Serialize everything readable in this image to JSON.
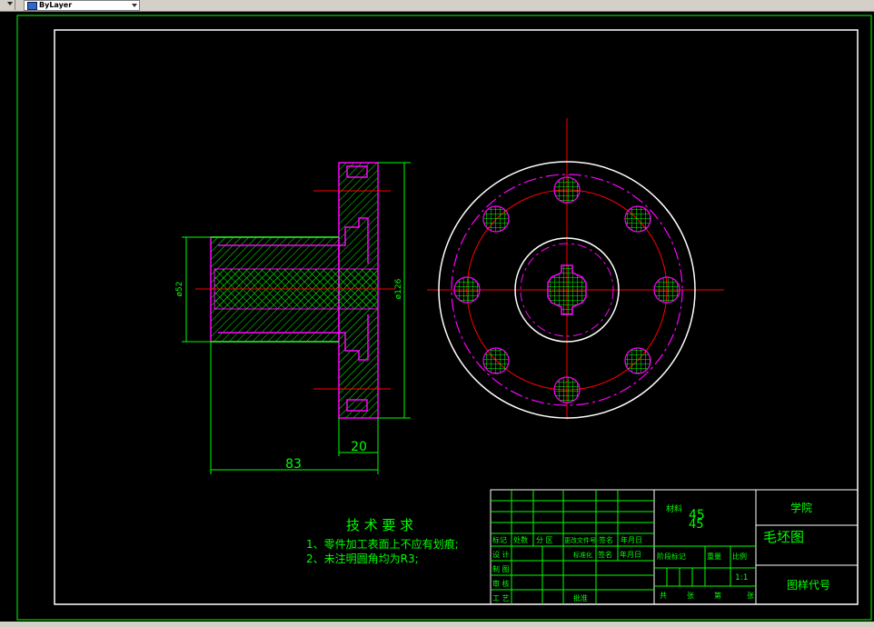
{
  "toolbar": {
    "combo_value": "ByLayer",
    "arrow_icon": "chevron-down-icon",
    "combo_icon": "layer-icon"
  },
  "colors": {
    "background": "#000000",
    "dimension": "#00ff00",
    "outline": "#ffffff",
    "center_line": "#ff0000",
    "hidden_line": "#ff00ff",
    "hatch": "#00ff00"
  },
  "drawing": {
    "dims": {
      "d52": "ø52",
      "d126": "ø126",
      "len83": "83",
      "len20": "20"
    },
    "tech_req": {
      "title": "技 术 要 求",
      "line1": "1、零件加工表面上不应有划痕;",
      "line2": "2、未注明圆角均为R3;"
    },
    "title_block": {
      "material_label": "材料",
      "material_value": "45",
      "material_value2": "45",
      "school": "学院",
      "drawing_name": "毛坯图",
      "drawing_code": "图样代号",
      "scale": "1:1",
      "c_mark": "标记",
      "c_count": "处数",
      "c_zone": "分 区",
      "c_doc": "更改文件号",
      "c_sign": "签名",
      "c_date": "年月日",
      "r_design": "设 计",
      "r_draw": "制 图",
      "r_check": "审 核",
      "r_process": "工 艺",
      "m_std": "标准化",
      "m_sign": "签名",
      "m_date": "年月日",
      "m_approve": "批准",
      "stage": "阶段标记",
      "weight": "重量",
      "ratio": "比例",
      "total": "共",
      "sheets": "张",
      "page": "第",
      "sheets2": "张"
    }
  }
}
